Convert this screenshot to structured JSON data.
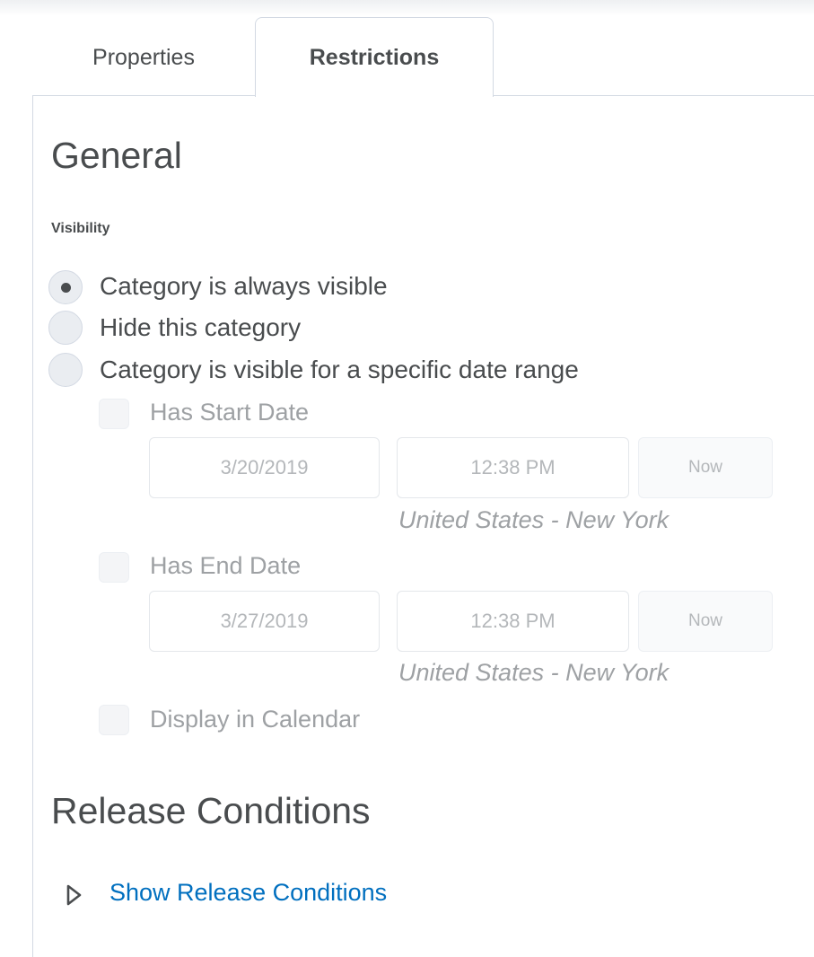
{
  "tabs": [
    {
      "label": "Properties",
      "active": false
    },
    {
      "label": "Restrictions",
      "active": true
    }
  ],
  "general": {
    "heading": "General",
    "visibility_label": "Visibility",
    "options": [
      {
        "label": "Category is always visible",
        "selected": true
      },
      {
        "label": "Hide this category",
        "selected": false
      },
      {
        "label": "Category is visible for a specific date range",
        "selected": false
      }
    ],
    "start": {
      "checkbox_label": "Has Start Date",
      "date": "3/20/2019",
      "time": "12:38 PM",
      "now_label": "Now",
      "timezone": "United States - New York"
    },
    "end": {
      "checkbox_label": "Has End Date",
      "date": "3/27/2019",
      "time": "12:38 PM",
      "now_label": "Now",
      "timezone": "United States - New York"
    },
    "calendar_label": "Display in Calendar"
  },
  "release": {
    "heading": "Release Conditions",
    "show_link": "Show Release Conditions",
    "expand_icon": "triangle-right-icon"
  },
  "colors": {
    "link": "#006fbf",
    "text": "#494c4e",
    "disabled_text": "#9ea1a4",
    "border": "#d3d9e3"
  }
}
